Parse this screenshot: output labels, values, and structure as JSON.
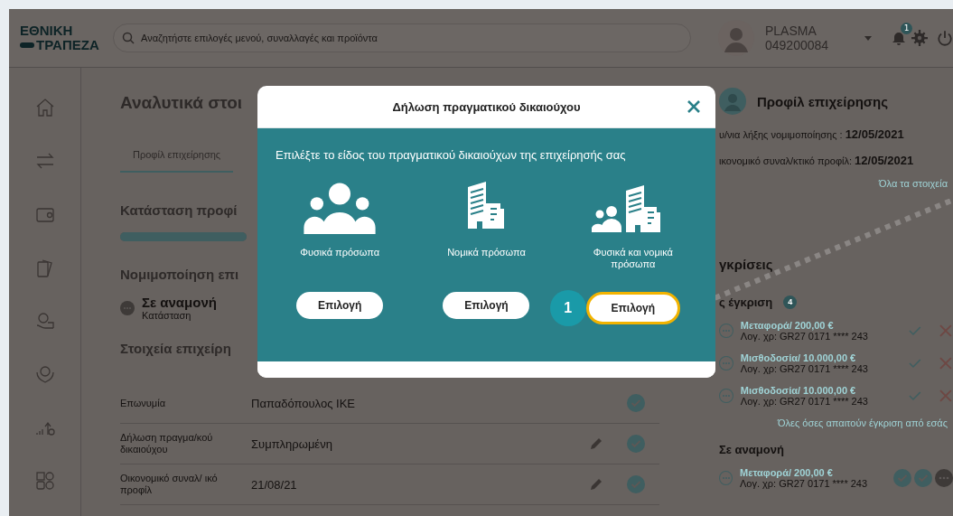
{
  "header": {
    "logo": [
      "ΕΘΝΙΚΗ",
      "ΤΡΑΠΕΖΑ"
    ],
    "search": {
      "placeholder": "Αναζητήστε επιλογές μενού, συναλλαγές και προϊόντα"
    },
    "user": {
      "name": "PLASMA",
      "id": "049200084"
    },
    "notifications": "1"
  },
  "page": {
    "title": "Αναλυτικά στοι",
    "tabs": [
      {
        "label": "Προφίλ επιχείρησης",
        "selected": true
      }
    ],
    "profile_status": {
      "title": "Κατάσταση προφί",
      "level": 1
    },
    "legalization": {
      "title": "Νομιμοποίηση επι",
      "status": "Σε αναμονή",
      "status_label": "Κατάσταση"
    },
    "details": {
      "title": "Στοιχεία επιχείρη",
      "rows": [
        {
          "label": "Επωνυμία",
          "value": "Παπαδόπουλος ΙΚΕ",
          "editable": false,
          "verified": true
        },
        {
          "label": "Δήλωση πραγμα/κού δικαιούχου",
          "value": "Συμπληρωμένη",
          "editable": true,
          "verified": true
        },
        {
          "label": "Οικονομικό συναλ/ ικό προφίλ",
          "value": "21/08/21",
          "editable": true,
          "verified": true
        }
      ]
    }
  },
  "profile_panel": {
    "title": "Προφίλ επιχείρησης",
    "lines": [
      {
        "label": "υ/νια λήξης νομιμοποίησης :",
        "value": "12/05/2021"
      },
      {
        "label": "ικονομικό συναλ/κτικό προφίλ:",
        "value": "12/05/2021"
      }
    ],
    "link": "Όλα τα στοιχεία"
  },
  "approvals": {
    "title": "γκρίσεις",
    "awaiting": {
      "title": "ς έγκριση",
      "count": "4",
      "items": [
        {
          "title": "Μεταφορά/ 200,00 €",
          "account": "Λογ. χρ: GR27 0171 **** 243"
        },
        {
          "title": "Μισθοδοσία/ 10.000,00 €",
          "account": "Λογ. χρ: GR27 0171 **** 243"
        },
        {
          "title": "Μισθοδοσία/ 10.000,00 €",
          "account": "Λογ. χρ: GR27 0171 **** 243"
        }
      ]
    },
    "link": "Όλες όσες απαιτούν έγκριση από εσάς",
    "pending": {
      "title": "Σε αναμονή",
      "items": [
        {
          "title": "Μεταφορά/ 200,00 €",
          "account": "Λογ. χρ: GR27 0171 **** 243",
          "steps": [
            {
              "kind": "done"
            },
            {
              "kind": "done"
            },
            {
              "kind": "waiting"
            }
          ]
        }
      ]
    }
  },
  "modal": {
    "title": "Δήλωση πραγματικού δικαιούχου",
    "prompt": "Επιλέξτε το είδος του πραγματικού δικαιούχων της επιχείρησής σας",
    "step_marker": "1",
    "options": [
      {
        "kind": "people",
        "label": "Φυσικά πρόσωπα",
        "button": "Επιλογή",
        "selected": false
      },
      {
        "kind": "building",
        "label": "Νομικά πρόσωπα",
        "button": "Επιλογή",
        "selected": false
      },
      {
        "kind": "people_building",
        "label": "Φυσικά και νομικά πρόσωπα",
        "button": "Επιλογή",
        "selected": true
      }
    ]
  }
}
